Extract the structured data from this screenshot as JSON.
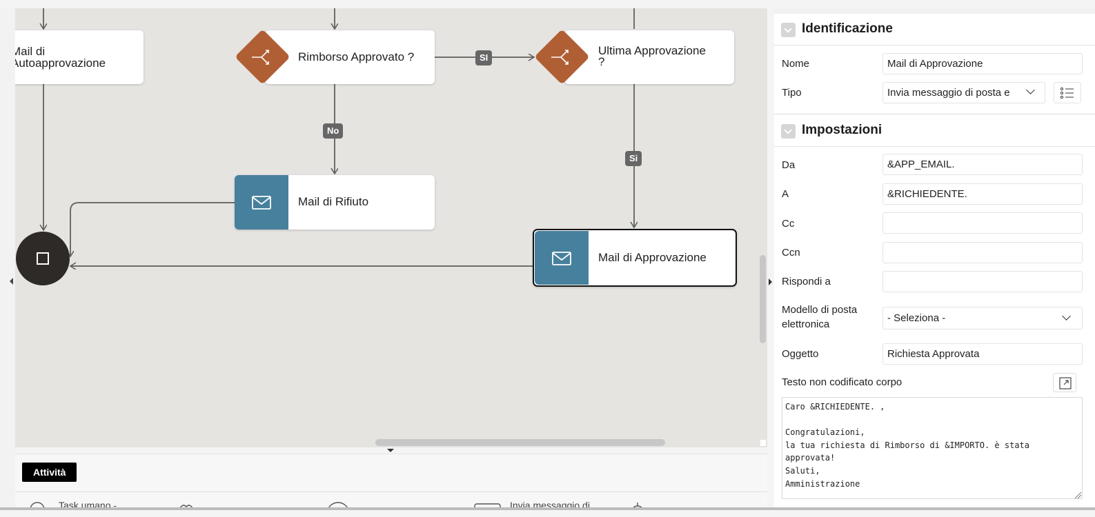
{
  "canvas": {
    "nodes": {
      "mail_autoapprovazione": "Mail di\nAutoapprovazione",
      "mail_autoapprovazione_line1": "Mail di",
      "mail_autoapprovazione_line2": "Autoapprovazione",
      "rimborso_approvato": "Rimborso Approvato ?",
      "ultima_approvazione_line1": "Ultima Approvazione",
      "ultima_approvazione_line2": "?",
      "mail_rifiuto": "Mail di Rifiuto",
      "mail_approvazione": "Mail di Approvazione"
    },
    "edge_labels": {
      "si_horizontal": "SI",
      "no": "No",
      "si_vertical": "Si"
    }
  },
  "palette": {
    "tab": "Attività",
    "items": [
      "Task umano -",
      "Invia messaggio di"
    ]
  },
  "properties": {
    "identificazione": {
      "title": "Identificazione",
      "nome_label": "Nome",
      "nome_value": "Mail di Approvazione",
      "tipo_label": "Tipo",
      "tipo_value": "Invia messaggio di posta e"
    },
    "impostazioni": {
      "title": "Impostazioni",
      "da_label": "Da",
      "da_value": "&APP_EMAIL.",
      "a_label": "A",
      "a_value": "&RICHIEDENTE.",
      "cc_label": "Cc",
      "cc_value": "",
      "ccn_label": "Ccn",
      "ccn_value": "",
      "rispondi_label": "Rispondi a",
      "rispondi_value": "",
      "modello_label_line1": "Modello di posta",
      "modello_label_line2": "elettronica",
      "modello_value": "- Seleziona -",
      "oggetto_label": "Oggetto",
      "oggetto_value": "Richiesta Approvata",
      "testo_label": "Testo non codificato corpo",
      "testo_value": "Caro &RICHIEDENTE. ,\n\nCongratulazioni,\nla tua richiesta di Rimborso di &IMPORTO. è stata\napprovata!\nSaluti,\nAmministrazione"
    }
  },
  "colors": {
    "canvas_bg": "#e5e4e1",
    "email_node": "#47809c",
    "gateway_node": "#b05f35",
    "end_node": "#2e2a27",
    "edge_label_bg": "#666666"
  }
}
